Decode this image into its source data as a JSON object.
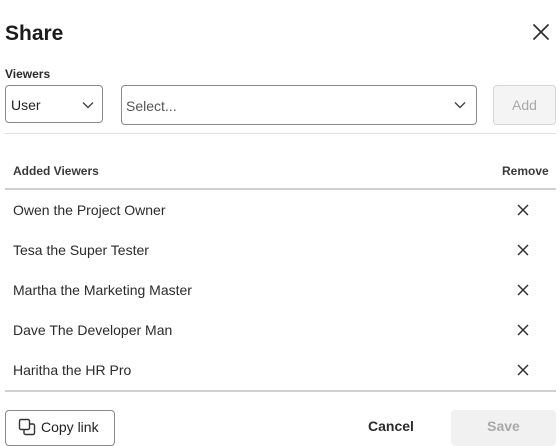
{
  "dialog": {
    "title": "Share",
    "close_icon": "close-icon"
  },
  "viewers": {
    "label": "Viewers",
    "type_select": {
      "value": "User",
      "icon": "chevron-down-icon"
    },
    "viewer_select": {
      "placeholder": "Select...",
      "icon": "chevron-down-icon"
    },
    "add_label": "Add",
    "add_enabled": false
  },
  "table": {
    "col_name": "Added Viewers",
    "col_remove": "Remove",
    "remove_icon": "x-icon",
    "rows": [
      {
        "name": "Owen the Project Owner"
      },
      {
        "name": "Tesa the Super Tester"
      },
      {
        "name": "Martha the Marketing Master"
      },
      {
        "name": "Dave The Developer Man"
      },
      {
        "name": "Haritha the HR Pro"
      }
    ]
  },
  "footer": {
    "copy_link_label": "Copy link",
    "copy_icon": "copy-icon",
    "cancel_label": "Cancel",
    "save_label": "Save",
    "save_enabled": false
  }
}
